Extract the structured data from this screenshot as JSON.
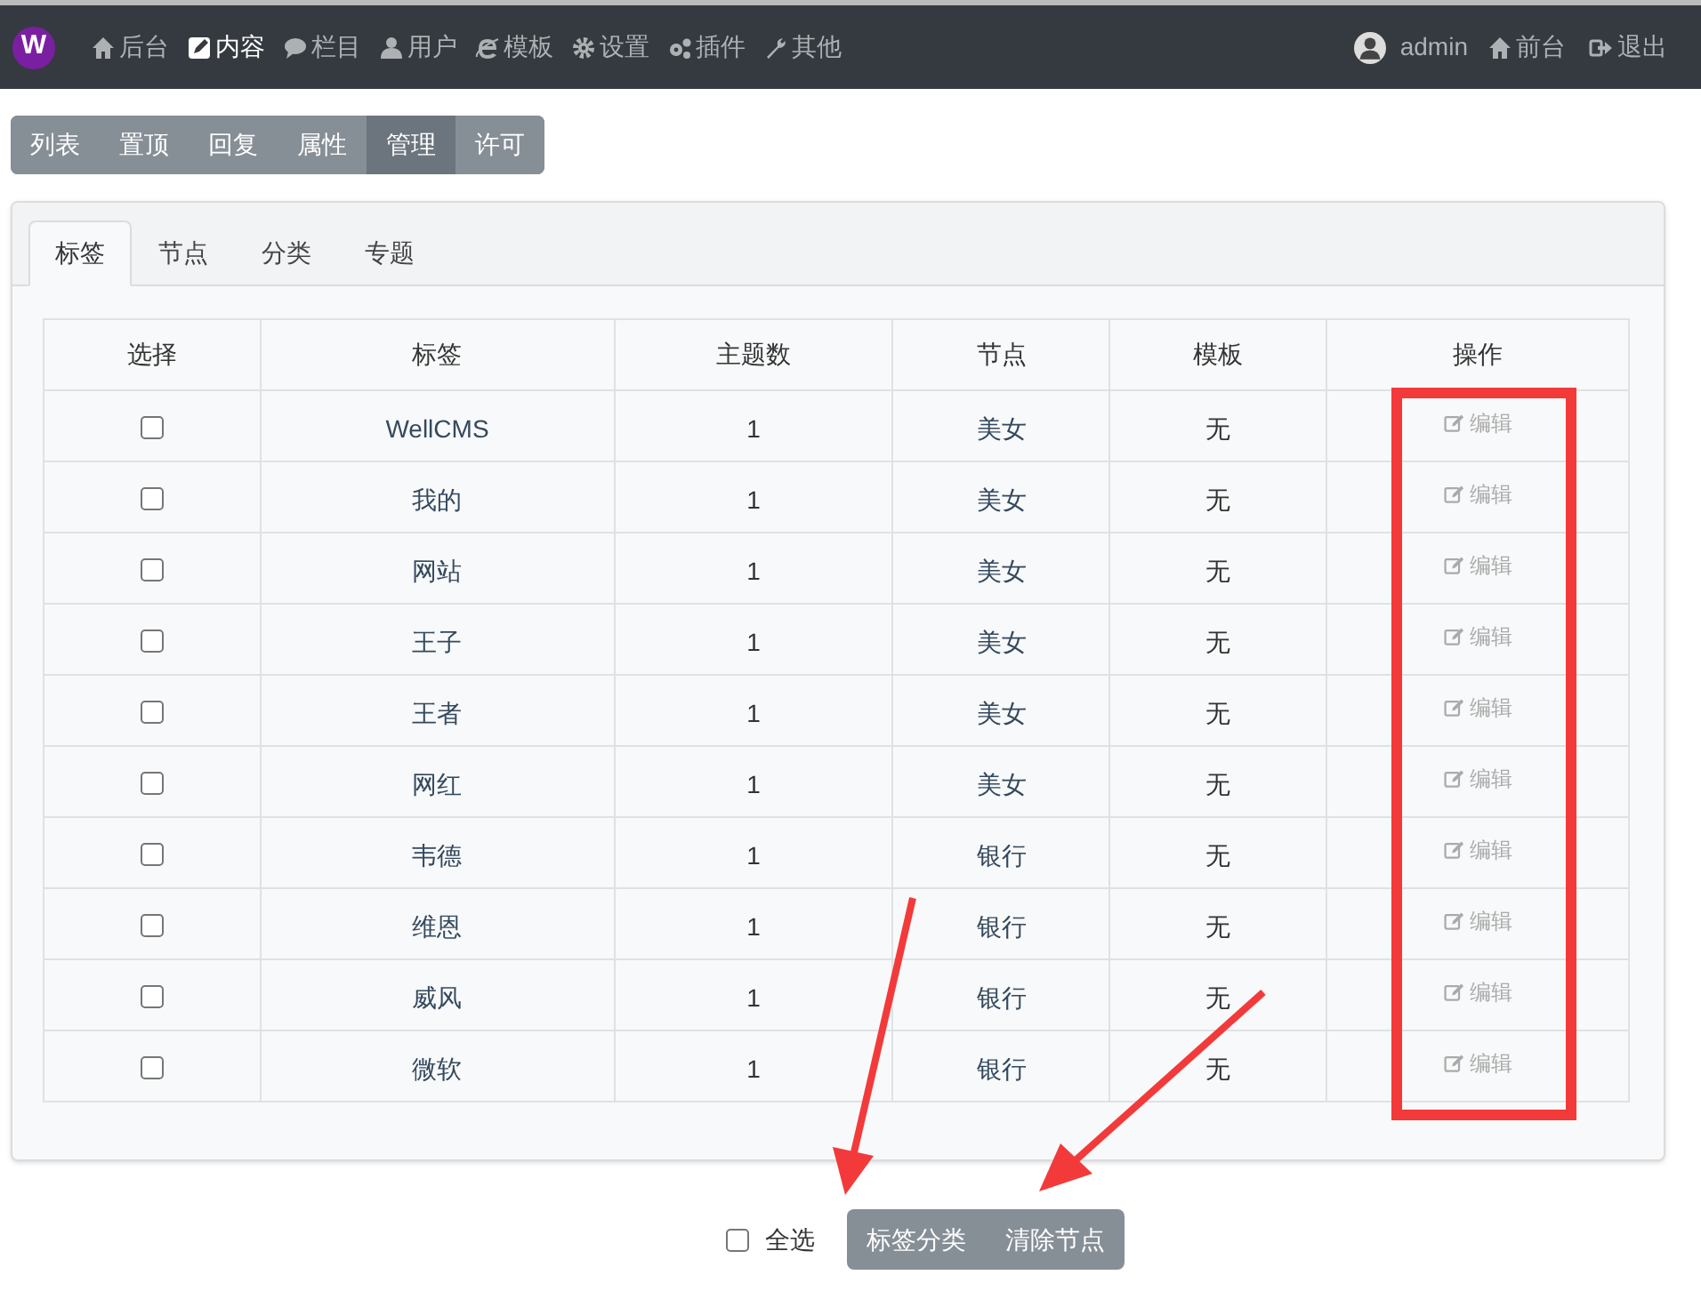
{
  "navbar": {
    "logo": "W",
    "items": [
      {
        "label": "后台",
        "selected": false
      },
      {
        "label": "内容",
        "selected": true
      },
      {
        "label": "栏目",
        "selected": false
      },
      {
        "label": "用户",
        "selected": false
      },
      {
        "label": "模板",
        "selected": false
      },
      {
        "label": "设置",
        "selected": false
      },
      {
        "label": "插件",
        "selected": false
      },
      {
        "label": "其他",
        "selected": false
      }
    ],
    "user": "admin",
    "links": [
      {
        "label": "前台"
      },
      {
        "label": "退出"
      }
    ]
  },
  "subnav": [
    {
      "label": "列表",
      "selected": false
    },
    {
      "label": "置顶",
      "selected": false
    },
    {
      "label": "回复",
      "selected": false
    },
    {
      "label": "属性",
      "selected": false
    },
    {
      "label": "管理",
      "selected": true
    },
    {
      "label": "许可",
      "selected": false
    }
  ],
  "tabs": [
    {
      "label": "标签",
      "selected": true
    },
    {
      "label": "节点",
      "selected": false
    },
    {
      "label": "分类",
      "selected": false
    },
    {
      "label": "专题",
      "selected": false
    }
  ],
  "table": {
    "columns": [
      "选择",
      "标签",
      "主题数",
      "节点",
      "模板",
      "操作"
    ],
    "rows": [
      {
        "checked": false,
        "tag": "WellCMS",
        "topics": "1",
        "node": "美女",
        "template": "无",
        "action": "编辑"
      },
      {
        "checked": false,
        "tag": "我的",
        "topics": "1",
        "node": "美女",
        "template": "无",
        "action": "编辑"
      },
      {
        "checked": false,
        "tag": "网站",
        "topics": "1",
        "node": "美女",
        "template": "无",
        "action": "编辑"
      },
      {
        "checked": false,
        "tag": "王子",
        "topics": "1",
        "node": "美女",
        "template": "无",
        "action": "编辑"
      },
      {
        "checked": false,
        "tag": "王者",
        "topics": "1",
        "node": "美女",
        "template": "无",
        "action": "编辑"
      },
      {
        "checked": false,
        "tag": "网红",
        "topics": "1",
        "node": "美女",
        "template": "无",
        "action": "编辑"
      },
      {
        "checked": false,
        "tag": "韦德",
        "topics": "1",
        "node": "银行",
        "template": "无",
        "action": "编辑"
      },
      {
        "checked": false,
        "tag": "维恩",
        "topics": "1",
        "node": "银行",
        "template": "无",
        "action": "编辑"
      },
      {
        "checked": false,
        "tag": "威风",
        "topics": "1",
        "node": "银行",
        "template": "无",
        "action": "编辑"
      },
      {
        "checked": false,
        "tag": "微软",
        "topics": "1",
        "node": "银行",
        "template": "无",
        "action": "编辑"
      }
    ]
  },
  "footer": {
    "select_all": {
      "label": "全选",
      "checked": false
    },
    "buttons": [
      "标签分类",
      "清除节点"
    ]
  }
}
